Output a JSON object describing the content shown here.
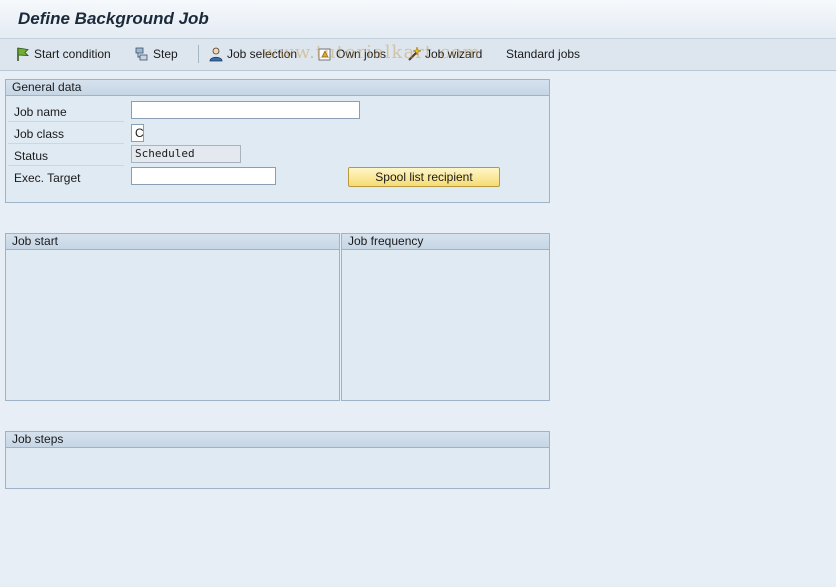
{
  "window": {
    "title": "Define Background Job"
  },
  "toolbar": {
    "start_condition": "Start condition",
    "step": "Step",
    "job_selection": "Job selection",
    "own_jobs": "Own jobs",
    "job_wizard": "Job wizard",
    "standard_jobs": "Standard jobs"
  },
  "watermark": "www.tutorialkart.com",
  "general_data": {
    "header": "General data",
    "job_name": {
      "label": "Job name",
      "value": ""
    },
    "job_class": {
      "label": "Job class",
      "value": "C"
    },
    "status": {
      "label": "Status",
      "value": "Scheduled"
    },
    "exec_target": {
      "label": "Exec. Target",
      "value": ""
    },
    "spool_button": "Spool list recipient"
  },
  "job_start": {
    "header": "Job start"
  },
  "job_frequency": {
    "header": "Job frequency"
  },
  "job_steps": {
    "header": "Job steps"
  },
  "colors": {
    "background": "#e8eef5",
    "panel": "#e0eaf3",
    "panel_border": "#9fb2c6",
    "button_yellow": "#f6dc74"
  }
}
